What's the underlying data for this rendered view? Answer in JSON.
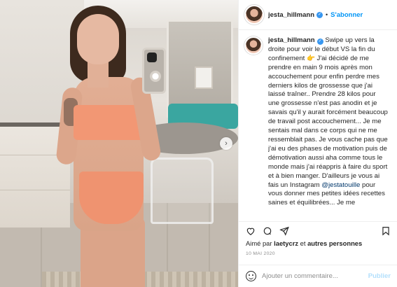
{
  "header": {
    "username": "jesta_hillmann",
    "separator": "•",
    "follow_label": "S'abonner"
  },
  "photo": {
    "next_glyph": "›"
  },
  "caption": {
    "username": "jesta_hillmann",
    "text_1": " Swipe up vers la droite pour voir le début VS la fin du confinement ",
    "emoji": "👉",
    "text_2": " J'ai décidé de me prendre en main 9 mois après mon accouchement pour enfin perdre mes derniers kilos de grossesse que j'ai laissé traîner.. Prendre 28 kilos pour une grossesse n'est pas anodin et je savais qu'il y aurait forcément beaucoup de travail post accouchement... Je me sentais mal dans ce corps qui ne me ressemblait pas. Je vous cache pas que j'ai eu des phases de motivation puis de démotivation aussi aha comme tous le monde mais j'ai réappris à faire du sport et à bien manger. D'ailleurs je vous ai fais un Instagram ",
    "mention": "@jestatouille",
    "text_3": " pour vous donner mes petites idées recettes saines et équilibrées... Je me"
  },
  "actions": {
    "icons": [
      "heart-icon",
      "comment-icon",
      "share-icon",
      "bookmark-icon"
    ]
  },
  "likes": {
    "prefix": "Aimé par ",
    "user": "laetycrz",
    "middle": " et ",
    "others": "autres personnes"
  },
  "date": "10 MAI 2020",
  "comment": {
    "placeholder": "Ajouter un commentaire...",
    "publish_label": "Publier"
  },
  "colors": {
    "accent": "#0095f6",
    "publish_disabled": "#b2dffc",
    "verified": "#3897f0"
  }
}
